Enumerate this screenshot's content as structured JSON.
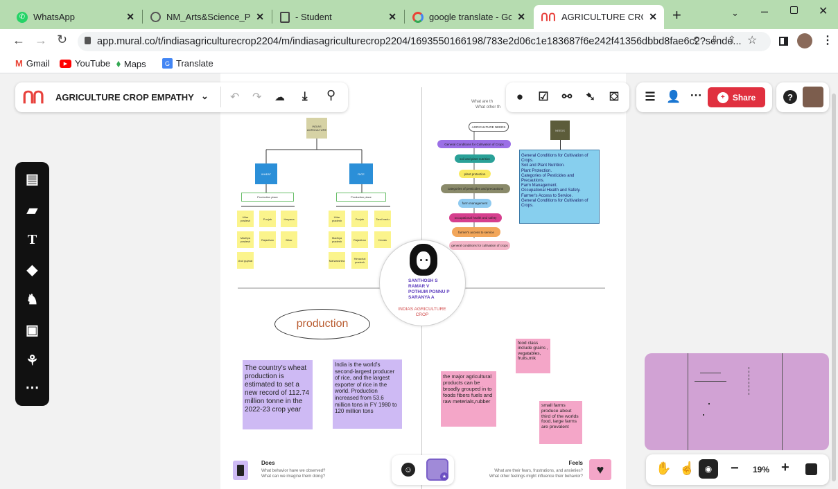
{
  "browser": {
    "tabs": [
      {
        "title": "WhatsApp",
        "active": false
      },
      {
        "title": "NM_Arts&Science_Proje",
        "active": false
      },
      {
        "title": "- Student",
        "active": false
      },
      {
        "title": "google translate - Googl",
        "active": false
      },
      {
        "title": "AGRICULTURE CROP EMI",
        "active": true
      }
    ],
    "url": "app.mural.co/t/indiasagriculturecrop2204/m/indiasagriculturecrop2204/1693550166198/783e2d06c1e183687f6e242f41356dbbd8fae6c2?sende...",
    "bookmarks": [
      "Gmail",
      "YouTube",
      "Maps",
      "Translate"
    ],
    "colors": {
      "tabbar": "#b6dcb0"
    }
  },
  "mural": {
    "title": "AGRICULTURE CROP EMPATHY",
    "share_label": "Share",
    "zoom": "19%"
  },
  "board": {
    "top_left": {
      "root": "INDIAS AGRICULTURE",
      "wheat": "WHEAT",
      "rice": "RICE",
      "prod_left": "Production place",
      "prod_right": "Production place",
      "wheat_places": [
        "Uttar pradesh",
        "Punjab",
        "Haryana",
        "Madhya pradesh",
        "Rajasthan",
        "Bihar",
        "And gujarat"
      ],
      "rice_places": [
        "Uttar pradesh",
        "Punjab",
        "Tamil nadu",
        "Madhya pradesh",
        "Rajasthan",
        "Kerala",
        "Maharashtra",
        "Himachal pradesh"
      ]
    },
    "top_right": {
      "header_left": "What are th",
      "header_left2": "What other th",
      "needs": "AGRICULTURE NEEDS",
      "steps": [
        "General Conditions for Cultivation of Crops",
        "soil and plant nutrition",
        "plant protection",
        "categories of pesticides and precautions",
        "farm management",
        "occupational health and safety",
        "farmer's access to service",
        "general conditions for cultivation of crops"
      ],
      "dark_label": "NEEDS",
      "blue_note": "General Conditions for Cultivation of Crops.\nSoil and Plant Nutrition.\nPlant Protection.\nCategories of Pesticides and Precautions.\nFarm Management.\nOccupational Health and Safety.\nFarmer's Access to Service.\nGeneral Conditions for Cultivation of Crops."
    },
    "center": {
      "names": [
        "SANTHOSH S",
        "RAMAR V",
        "POTHUM PONNU P",
        "SARANYA A"
      ],
      "subtitle": "INDIAS AGRICULTURE CROP"
    },
    "bottom_left": {
      "oval": "production",
      "note1": "The country's wheat production is estimated to set a new record of 112.74 million tonne in the 2022-23 crop year",
      "note2": "India is the world's second-largest producer of rice, and the largest exporter of rice in the world. Production increased from 53.6 million tons in FY 1980 to 120 million tons",
      "does_title": "Does",
      "does_q1": "What behavior have we observed?",
      "does_q2": "What can we imagine them doing?"
    },
    "bottom_right": {
      "note1": "food class include grains , vegatables, fruits,mik",
      "note2": "the major agricultural products can be broadly grouped in to foods fibers fuels and raw meterials,rubber",
      "note3": "small farms produce about third of the worlds food, large farms are prevalent",
      "feels_title": "Feels",
      "feels_q1": "What are their fears, frustrations, and anxieties?",
      "feels_q2": "What other feelings might influence their behavior?"
    }
  },
  "icons": {
    "left_toolbar": [
      "outline-icon",
      "sticky-note-icon",
      "text-icon",
      "shapes-icon",
      "llama-icon",
      "image-icon",
      "diagram-icon",
      "more-icon"
    ]
  }
}
